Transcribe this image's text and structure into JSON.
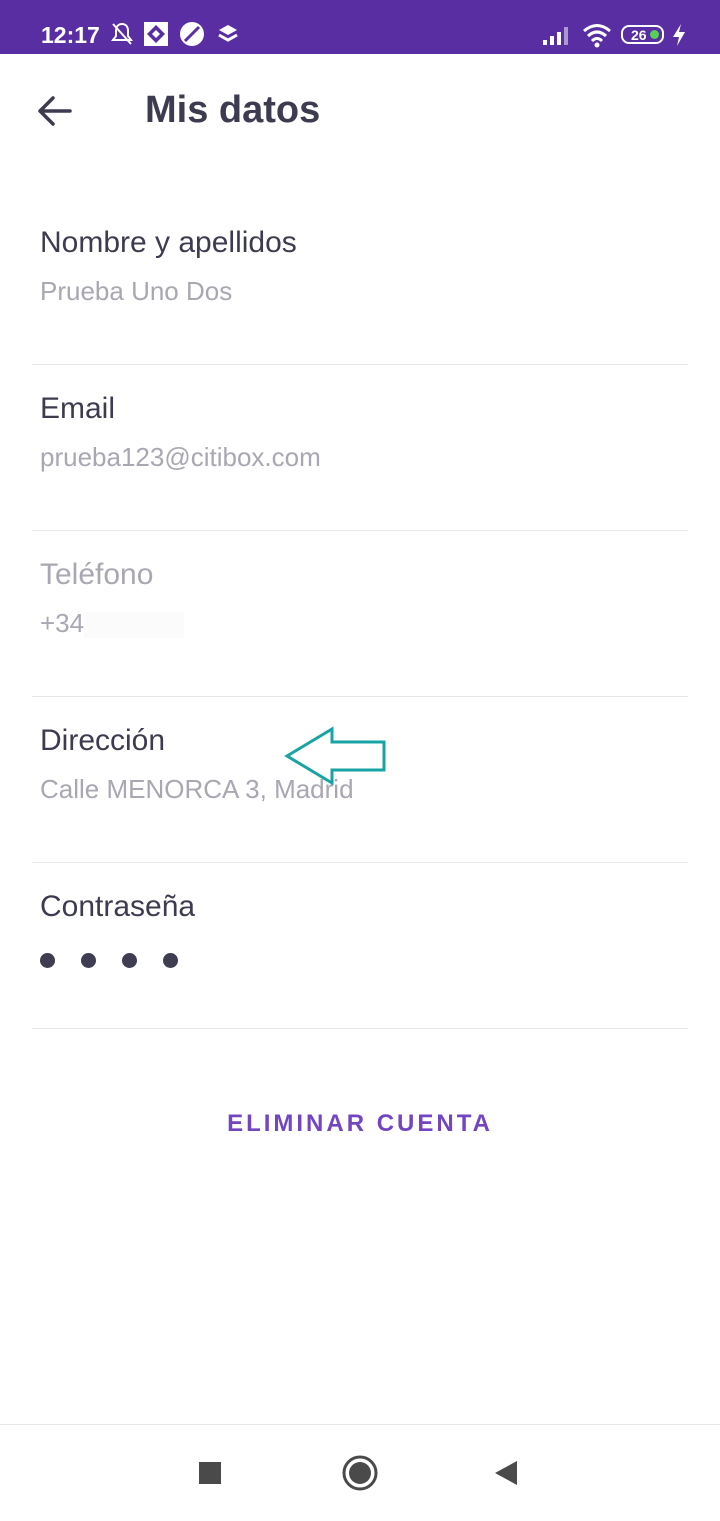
{
  "status_bar": {
    "time": "12:17",
    "battery": "26",
    "left_icons": [
      "bell-off-icon",
      "kite-app-icon",
      "browser-app-icon",
      "dropbox-icon"
    ],
    "right_icons": [
      "signal-icon",
      "wifi-icon",
      "battery-icon",
      "charging-icon"
    ]
  },
  "header": {
    "title": "Mis datos",
    "back_icon": "arrow-left-icon"
  },
  "fields": {
    "name": {
      "label": "Nombre y apellidos",
      "value": "Prueba Uno Dos"
    },
    "email": {
      "label": "Email",
      "value": "prueba123@citibox.com"
    },
    "phone": {
      "label": "Teléfono",
      "value": "+34"
    },
    "address": {
      "label": "Dirección",
      "value": "Calle MENORCA 3, Madrid"
    },
    "password": {
      "label": "Contraseña",
      "dot_count": 4
    }
  },
  "delete_account": {
    "label": "ELIMINAR CUENTA"
  },
  "nav_bar": {
    "icons": [
      "recents-square-icon",
      "home-circle-icon",
      "back-triangle-icon"
    ]
  },
  "colors": {
    "status_bar": "#5a2ea3",
    "title": "#3d3b4f",
    "value_text": "#a8a7b2",
    "accent": "#7345c0",
    "annotation_arrow": "#1aa3a3"
  }
}
